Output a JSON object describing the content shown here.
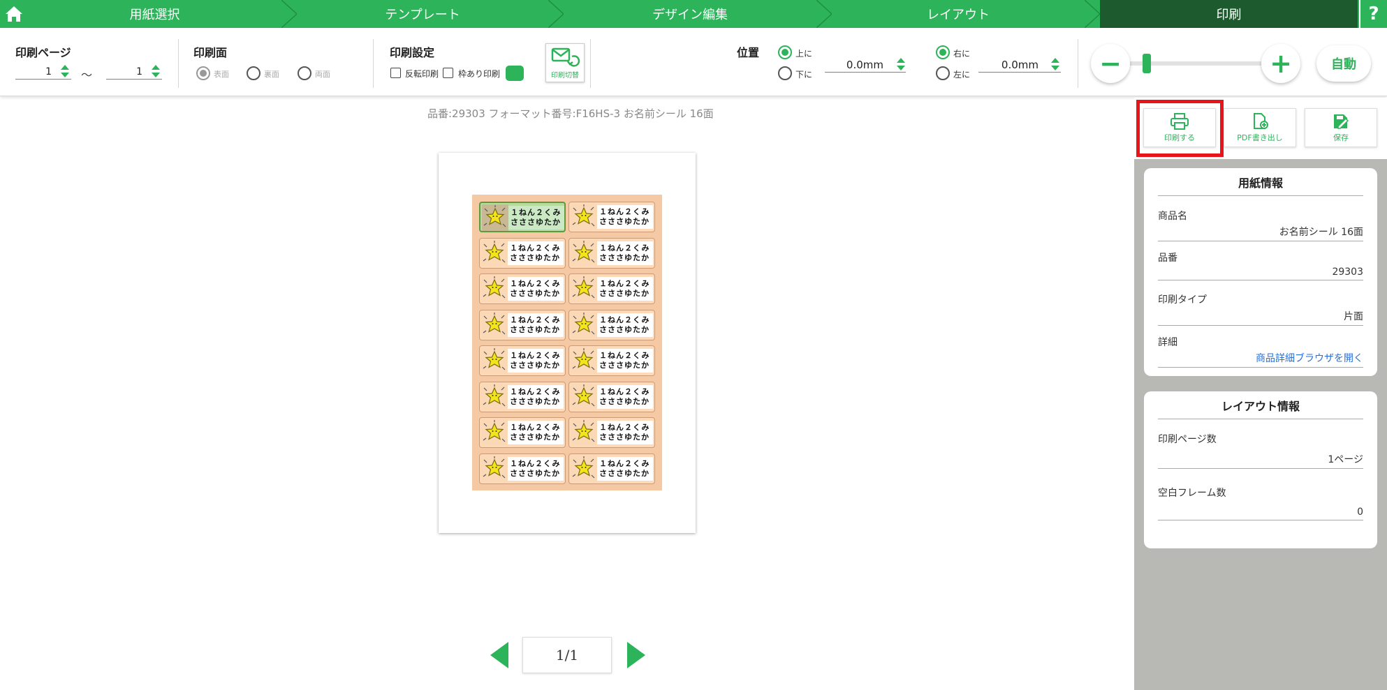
{
  "steps": [
    "用紙選択",
    "テンプレート",
    "デザイン編集",
    "レイアウト",
    "印刷"
  ],
  "help_label": "?",
  "toolbar": {
    "print_pages": {
      "title": "印刷ページ",
      "from": "1",
      "separator": "～",
      "to": "1"
    },
    "print_side": {
      "title": "印刷面",
      "options": [
        "表面",
        "裏面",
        "両面"
      ]
    },
    "print_settings": {
      "title": "印刷設定",
      "mirror_label": "反転印刷",
      "frame_label": "枠あり印刷",
      "switch_label": "印刷切替"
    },
    "position": {
      "title": "位置",
      "up": "上に",
      "down": "下に",
      "vertical_value": "0.0mm",
      "right": "右に",
      "left": "左に",
      "horizontal_value": "0.0mm"
    },
    "zoom": {
      "minus": "−",
      "plus": "+",
      "auto": "自動",
      "level": 0.05
    }
  },
  "canvas": {
    "caption": "品番:29303 フォーマット番号:F16HS-3 お名前シール 16面",
    "label_line1": "１ねん２くみ",
    "label_line2": "さささゆたか",
    "page_indicator": "1/1"
  },
  "actions": {
    "print": "印刷する",
    "pdf": "PDF書き出し",
    "save": "保存"
  },
  "paper_info": {
    "title": "用紙情報",
    "product_name_label": "商品名",
    "product_name": "お名前シール 16面",
    "product_no_label": "品番",
    "product_no": "29303",
    "print_type_label": "印刷タイプ",
    "print_type": "片面",
    "detail_label": "詳細",
    "detail_link": "商品詳細ブラウザを開く"
  },
  "layout_info": {
    "title": "レイアウト情報",
    "pages_label": "印刷ページ数",
    "pages": "1ページ",
    "blank_label": "空白フレーム数",
    "blank": "0"
  },
  "colors": {
    "accent": "#2db35a",
    "active_step": "#1d5b2e",
    "highlight": "#e8141b",
    "link": "#2a6fd6"
  }
}
